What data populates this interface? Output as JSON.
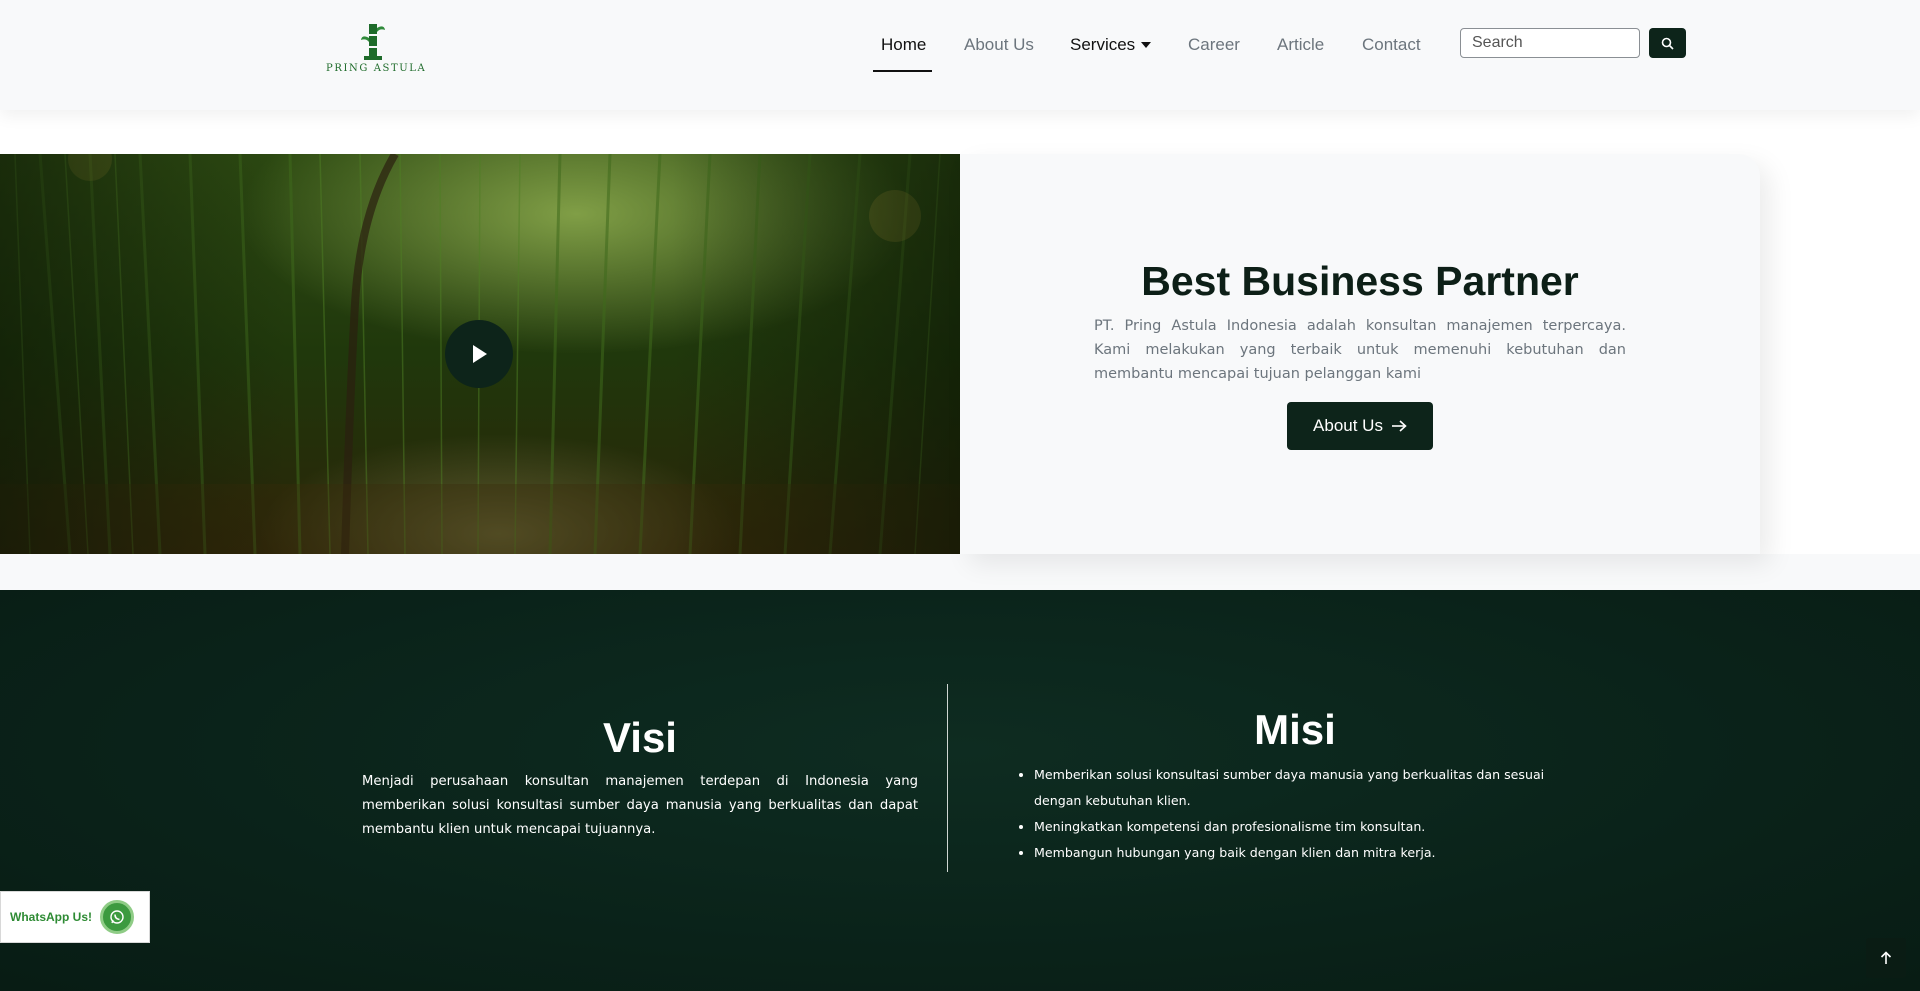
{
  "brand": {
    "name": "PRING ASTULA",
    "accent": "#0d241a",
    "logo_green": "#1e6b2a"
  },
  "nav": {
    "home": "Home",
    "about": "About Us",
    "services": "Services",
    "career": "Career",
    "article": "Article",
    "contact": "Contact"
  },
  "search": {
    "placeholder": "Search",
    "button_icon": "search-icon"
  },
  "hero": {
    "title": "Best Business Partner",
    "description": "PT. Pring Astula Indonesia adalah konsultan manajemen terpercaya. Kami melakukan yang terbaik untuk memenuhi kebutuhan dan membantu mencapai tujuan pelanggan kami",
    "button_label": "About Us",
    "button_icon": "arrow-right-icon",
    "video_icon": "play-icon"
  },
  "visi": {
    "title": "Visi",
    "text": "Menjadi perusahaan konsultan manajemen terdepan di Indonesia yang memberikan solusi konsultasi sumber daya manusia yang berkualitas dan dapat membantu klien untuk mencapai tujuannya."
  },
  "misi": {
    "title": "Misi",
    "items": [
      "Memberikan solusi konsultasi sumber daya manusia yang berkualitas dan sesuai dengan kebutuhan klien.",
      "Meningkatkan kompetensi dan profesionalisme tim konsultan.",
      "Membangun hubungan yang baik dengan klien dan mitra kerja."
    ]
  },
  "whatsapp": {
    "label": "WhatsApp Us!",
    "icon": "whatsapp-icon"
  },
  "back_to_top": {
    "icon": "arrow-up-icon"
  }
}
